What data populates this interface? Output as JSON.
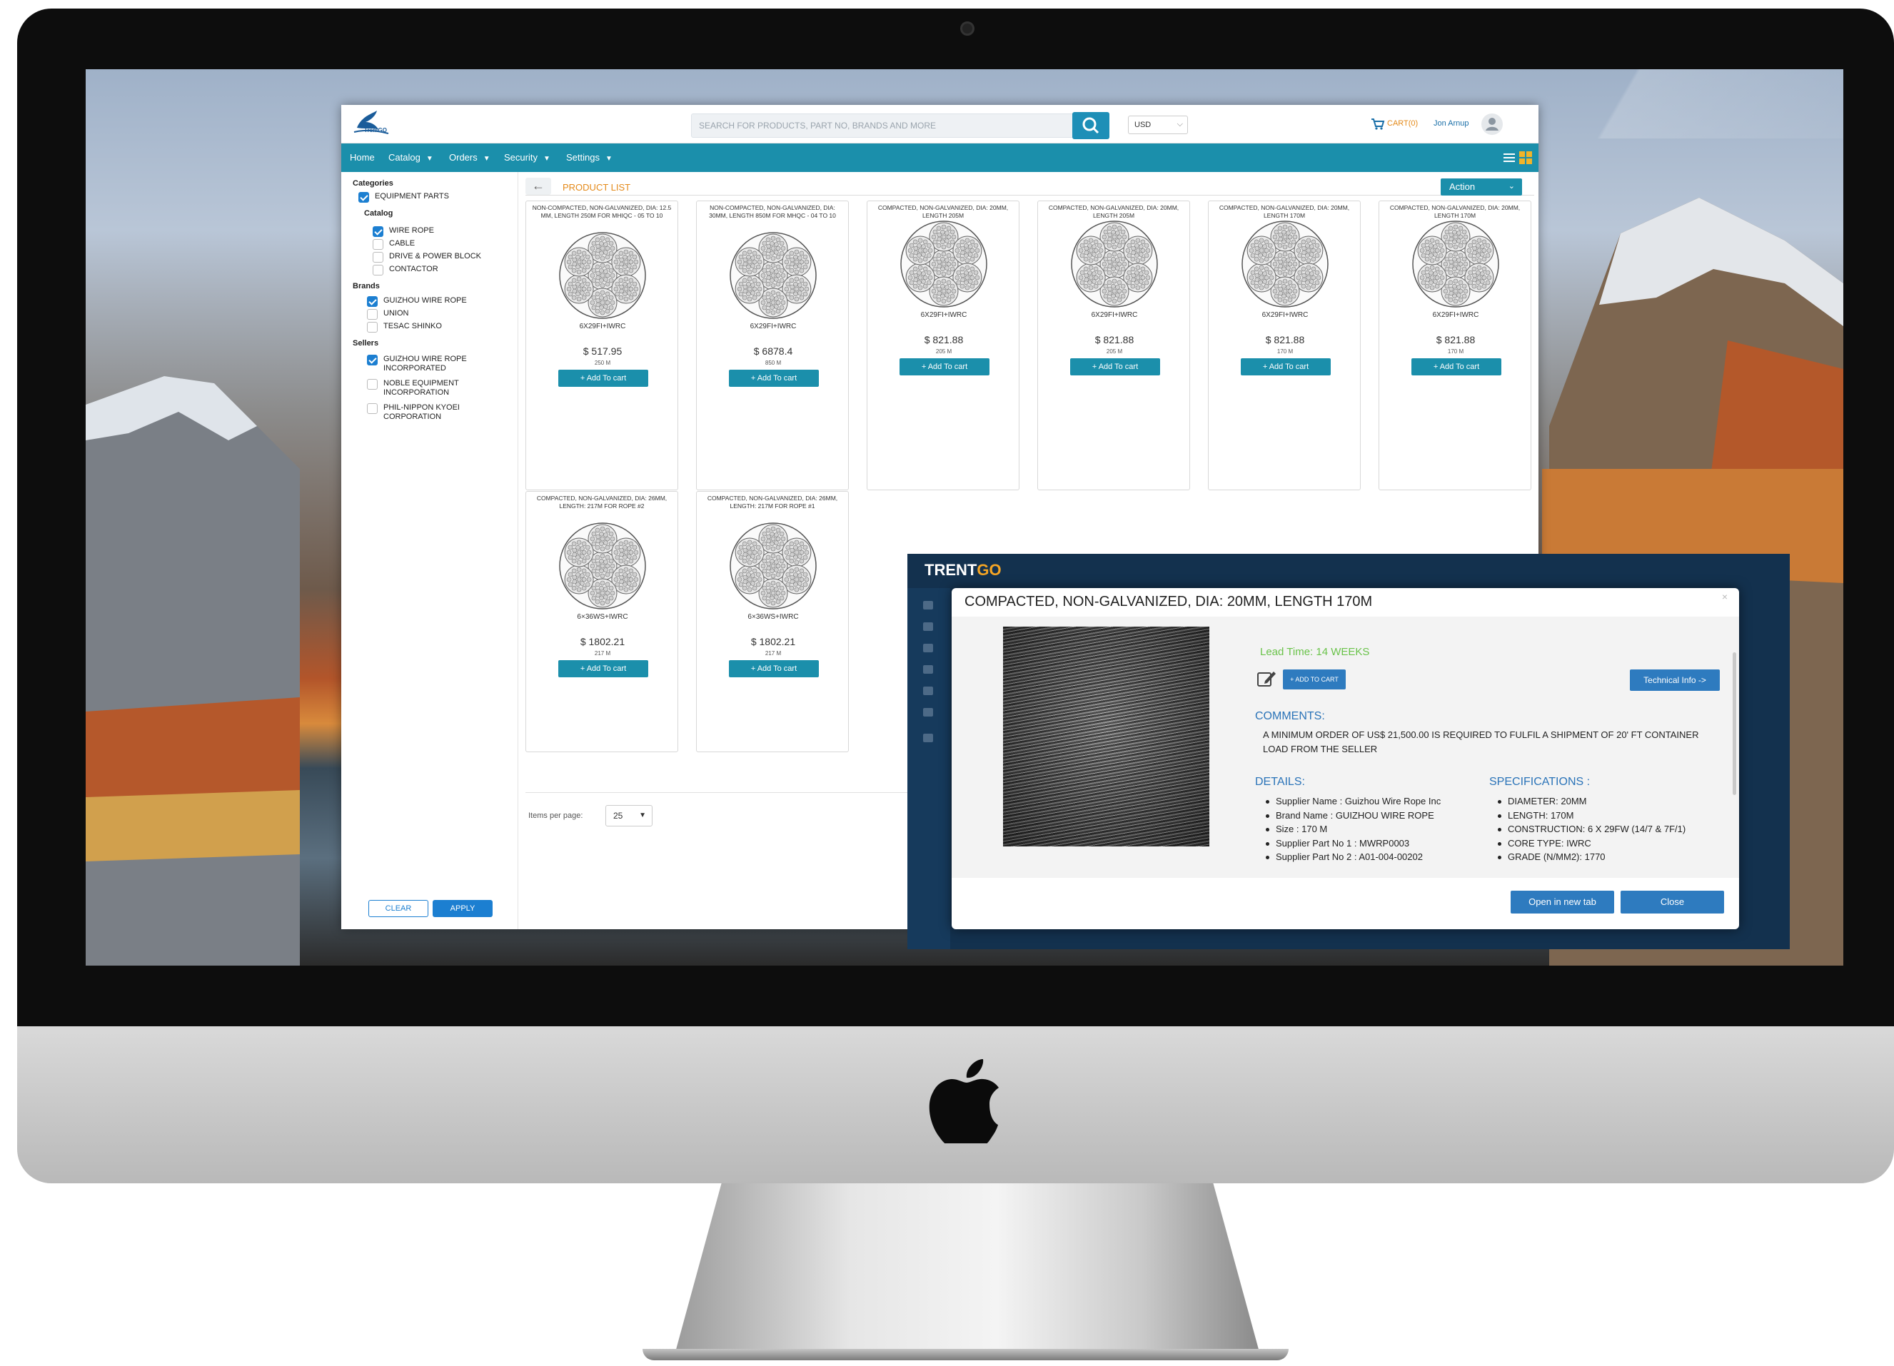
{
  "app": {
    "logo_text": "TrentGO",
    "search_placeholder": "SEARCH FOR PRODUCTS, PART NO, BRANDS AND MORE",
    "currency": "USD",
    "cart_label": "CART(0)",
    "user_name": "Jon Arnup"
  },
  "nav": [
    "Home",
    "Catalog",
    "Orders",
    "Security",
    "Settings"
  ],
  "sidebar": {
    "categories_heading": "Categories",
    "equipment_parts": "EQUIPMENT PARTS",
    "catalog_heading": "Catalog",
    "catalog_items": [
      {
        "label": "WIRE ROPE",
        "checked": true
      },
      {
        "label": "CABLE",
        "checked": false
      },
      {
        "label": "DRIVE & POWER BLOCK",
        "checked": false
      },
      {
        "label": "CONTACTOR",
        "checked": false
      }
    ],
    "brands_heading": "Brands",
    "brand_items": [
      {
        "label": "GUIZHOU WIRE ROPE",
        "checked": true
      },
      {
        "label": "UNION",
        "checked": false
      },
      {
        "label": "TESAC SHINKO",
        "checked": false
      }
    ],
    "sellers_heading": "Sellers",
    "seller_items": [
      {
        "label": "GUIZHOU WIRE ROPE INCORPORATED",
        "checked": true
      },
      {
        "label": "NOBLE EQUIPMENT INCORPORATION",
        "checked": false
      },
      {
        "label": "PHIL-NIPPON KYOEI CORPORATION",
        "checked": false
      }
    ],
    "clear_label": "CLEAR",
    "apply_label": "APPLY"
  },
  "main": {
    "back_arrow": "←",
    "title": "PRODUCT LIST",
    "action_label": "Action",
    "items_per_page_label": "Items per page:",
    "items_per_page_value": "25",
    "products": [
      {
        "title": "NON-COMPACTED, NON-GALVANIZED, DIA: 12.5 MM, LENGTH 250M FOR MHIQC - 05 TO 10",
        "code": "6X29FI+IWRC",
        "price": "$ 517.95",
        "length": "250 M",
        "button": "+ Add To cart"
      },
      {
        "title": "NON-COMPACTED, NON-GALVANIZED, DIA: 30MM, LENGTH 850M FOR MHQC - 04 TO 10",
        "code": "6X29FI+IWRC",
        "price": "$ 6878.4",
        "length": "850 M",
        "button": "+ Add To cart"
      },
      {
        "title": "COMPACTED, NON-GALVANIZED, DIA: 20MM, LENGTH 205M",
        "code": "6X29FI+IWRC",
        "price": "$ 821.88",
        "length": "205 M",
        "button": "+ Add To cart"
      },
      {
        "title": "COMPACTED, NON-GALVANIZED, DIA: 20MM, LENGTH 205M",
        "code": "6X29FI+IWRC",
        "price": "$ 821.88",
        "length": "205 M",
        "button": "+ Add To cart"
      },
      {
        "title": "COMPACTED, NON-GALVANIZED, DIA: 20MM, LENGTH 170M",
        "code": "6X29FI+IWRC",
        "price": "$ 821.88",
        "length": "170 M",
        "button": "+ Add To cart"
      },
      {
        "title": "COMPACTED, NON-GALVANIZED, DIA: 20MM, LENGTH 170M",
        "code": "6X29FI+IWRC",
        "price": "$ 821.88",
        "length": "170 M",
        "button": "+ Add To cart"
      },
      {
        "title": "COMPACTED, NON-GALVANIZED, DIA: 26MM, LENGTH: 217M FOR ROPE #2",
        "code": "6×36WS+IWRC",
        "price": "$ 1802.21",
        "length": "217 M",
        "button": "+ Add To cart"
      },
      {
        "title": "COMPACTED, NON-GALVANIZED, DIA: 26MM, LENGTH: 217M FOR ROPE #1",
        "code": "6×36WS+IWRC",
        "price": "$ 1802.21",
        "length": "217 M",
        "button": "+ Add To cart"
      }
    ]
  },
  "modal": {
    "brand_left": "TRENT",
    "brand_right": "GO",
    "title": "COMPACTED, NON-GALVANIZED, DIA: 20MM, LENGTH 170M",
    "close_x": "×",
    "lead_time": "Lead Time: 14 WEEKS",
    "add_to_cart": "+ ADD TO CART",
    "technical_info": "Technical Info ->",
    "comments_heading": "COMMENTS:",
    "comments": "A MINIMUM ORDER OF US$ 21,500.00 IS REQUIRED TO FULFIL A SHIPMENT OF 20' FT CONTAINER LOAD FROM THE SELLER",
    "details_heading": "DETAILS:",
    "details": [
      "Supplier Name : Guizhou Wire Rope Inc",
      "Brand Name : GUIZHOU WIRE ROPE",
      "Size : 170 M",
      "Supplier Part No 1 : MWRP0003",
      "Supplier Part No 2 : A01-004-00202"
    ],
    "specs_heading": "SPECIFICATIONS :",
    "specs": [
      "DIAMETER: 20MM",
      "LENGTH: 170M",
      "CONSTRUCTION: 6 X 29FW (14/7 & 7F/1)",
      "CORE TYPE: IWRC",
      "GRADE (N/MM2): 1770"
    ],
    "open_new_tab": "Open in new tab",
    "close_label": "Close"
  },
  "colors": {
    "nav_teal": "#1b8fab",
    "accent_orange": "#e48a1a",
    "modal_blue": "#2e7bbf",
    "lead_green": "#6ac34a",
    "modal_frame": "#13314e"
  }
}
